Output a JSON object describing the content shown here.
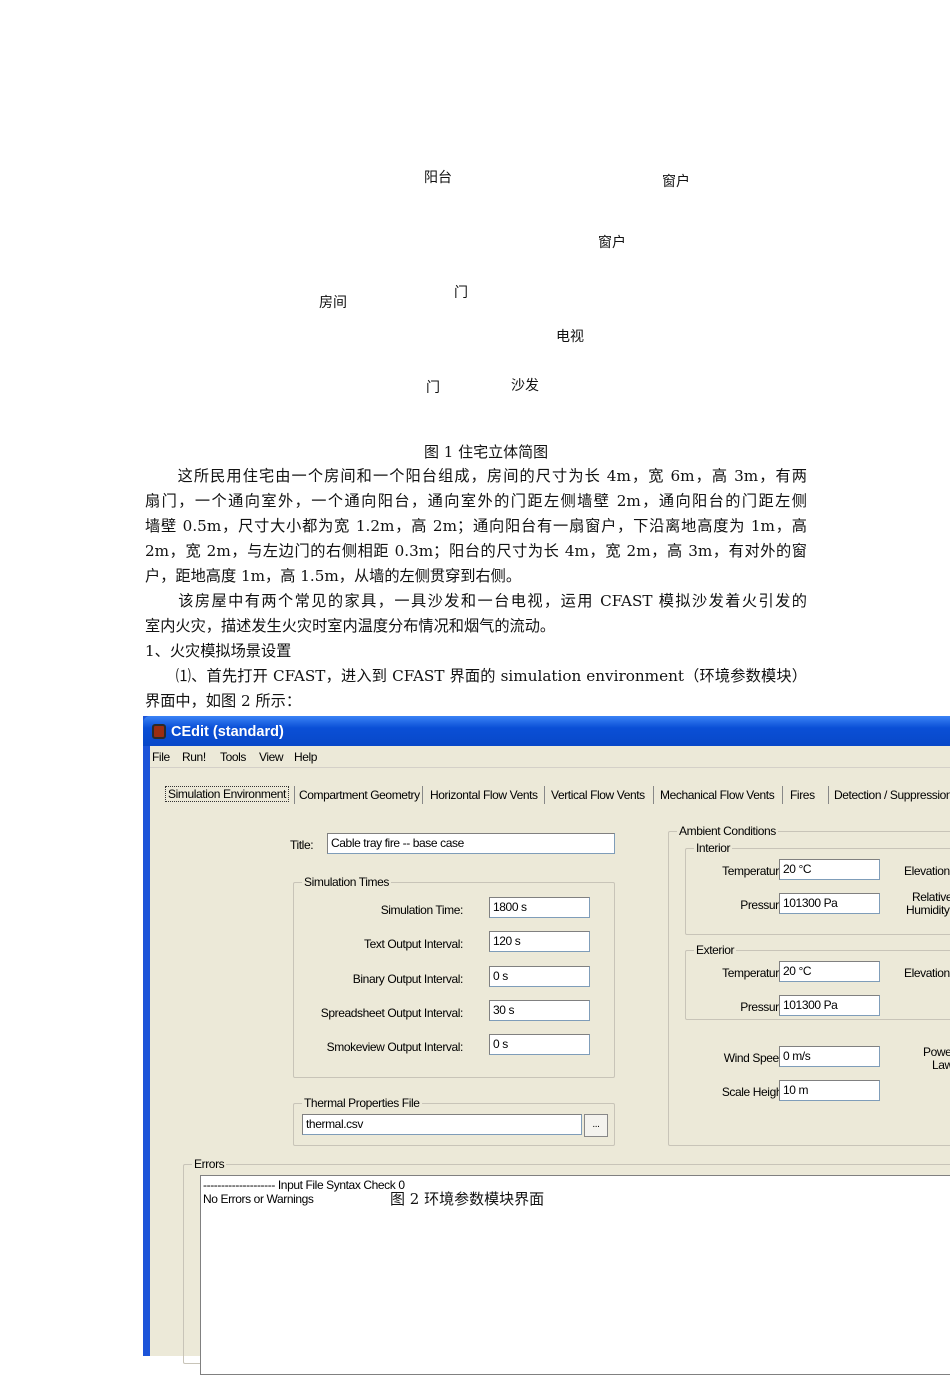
{
  "figure1": {
    "labels": {
      "balcony": "阳台",
      "window1": "窗户",
      "window2": "窗户",
      "door1": "门",
      "room": "房间",
      "tv": "电视",
      "door2": "门",
      "sofa": "沙发"
    },
    "caption": "图 1  住宅立体简图"
  },
  "body": {
    "lines": [
      "　　这所民用住宅由一个房间和一个阳台组成，房间的尺寸为长 4m，宽 6m，高 3m，有两",
      "扇门，一个通向室外，一个通向阳台，通向室外的门距左侧墙壁 2m，通向阳台的门距左侧",
      "墙壁 0.5m，尺寸大小都为宽 1.2m，高 2m；通向阳台有一扇窗户，下沿离地高度为 1m，高",
      "2m，宽 2m，与左边门的右侧相距 0.3m；阳台的尺寸为长 4m，宽 2m，高 3m，有对外的窗",
      "户，距地高度 1m，高 1.5m，从墙的左侧贯穿到右侧。",
      "　　该房屋中有两个常见的家具，一具沙发和一台电视，运用 CFAST 模拟沙发着火引发的",
      "室内火灾，描述发生火灾时室内温度分布情况和烟气的流动。",
      "1、火灾模拟场景设置",
      "　　⑴、首先打开 CFAST，进入到 CFAST 界面的 simulation environment（环境参数模块）",
      "界面中，如图 2 所示："
    ]
  },
  "window": {
    "title": "CEdit (standard)",
    "menu": [
      "File",
      "Run!",
      "Tools",
      "View",
      "Help"
    ],
    "tabs": [
      "Simulation Environment",
      "Compartment Geometry",
      "Horizontal Flow Vents",
      "Vertical Flow Vents",
      "Mechanical Flow Vents",
      "Fires",
      "Detection / Suppression"
    ],
    "title_label": "Title:",
    "title_value": "Cable tray fire -- base case",
    "sim_times": {
      "legend": "Simulation Times",
      "rows": [
        {
          "label": "Simulation Time:",
          "value": "1800 s"
        },
        {
          "label": "Text Output Interval:",
          "value": "120 s"
        },
        {
          "label": "Binary Output Interval:",
          "value": "0 s"
        },
        {
          "label": "Spreadsheet Output Interval:",
          "value": "30 s"
        },
        {
          "label": "Smokeview Output Interval:",
          "value": "0 s"
        }
      ]
    },
    "thermal": {
      "legend": "Thermal Properties File",
      "value": "thermal.csv",
      "browse": "..."
    },
    "ambient": {
      "legend": "Ambient Conditions",
      "interior": {
        "legend": "Interior",
        "temp_label": "Temperature:",
        "temp": "20 °C",
        "pres_label": "Pressure:",
        "pres": "101300 Pa",
        "elev_label": "Elevation",
        "rh_label1": "Relative",
        "rh_label2": "Humidity"
      },
      "exterior": {
        "legend": "Exterior",
        "temp_label": "Temperature:",
        "temp": "20 °C",
        "pres_label": "Pressure:",
        "pres": "101300 Pa",
        "elev_label": "Elevation"
      },
      "wind_label": "Wind Speed:",
      "wind": "0 m/s",
      "scale_label": "Scale Height:",
      "scale": "10 m",
      "power1": "Power",
      "power2": "Law"
    },
    "errors": {
      "legend": "Errors",
      "lines": [
        "-------------------- Input File Syntax Check 0",
        "No Errors or Warnings"
      ]
    }
  },
  "figure2": {
    "caption": "图 2  环境参数模块界面"
  }
}
